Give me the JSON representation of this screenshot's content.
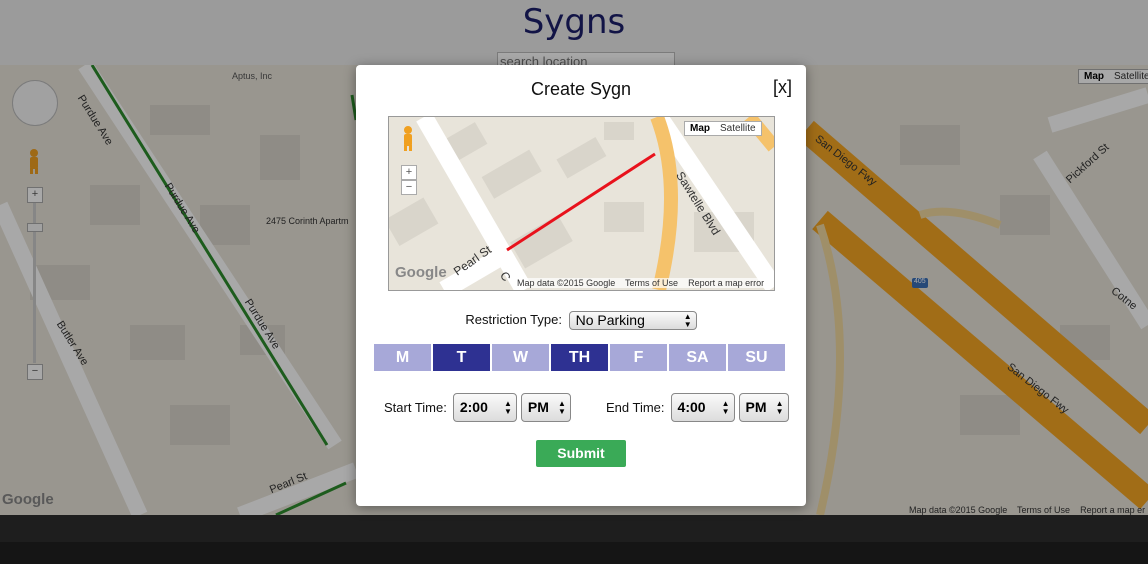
{
  "header": {
    "title": "Sygns",
    "search_placeholder": "search location"
  },
  "background_map": {
    "map_type": {
      "map": "Map",
      "satellite": "Satellite"
    },
    "labels": {
      "aptus": "Aptus, Inc",
      "apartments": "2475 Corinth Apartm",
      "purdue_1": "Purdue Ave",
      "purdue_2": "Purdue Ave",
      "purdue_3": "Purdue Ave",
      "butler": "Butler Ave",
      "pearl": "Pearl St",
      "san_diego_1": "San Diego Fwy",
      "san_diego_2": "San Diego Fwy",
      "pickford": "Pickford St",
      "cotner": "Cotne",
      "shield": "405"
    },
    "footer": {
      "data": "Map data ©2015 Google",
      "terms": "Terms of Use",
      "report": "Report a map er"
    },
    "logo": "Google",
    "zoom_in": "+",
    "zoom_out": "−"
  },
  "modal": {
    "title": "Create Sygn",
    "close_label": "[x]",
    "mini_map": {
      "map_type": {
        "map": "Map",
        "satellite": "Satellite"
      },
      "labels": {
        "sawtelle": "Sawtelle Blvd",
        "pearl": "Pearl St",
        "c": "C"
      },
      "zoom_in": "+",
      "zoom_out": "−",
      "logo": "Google",
      "footer": {
        "data": "Map data ©2015 Google",
        "terms": "Terms of Use",
        "report": "Report a map error"
      },
      "segment_color": "#e8121c"
    },
    "restriction": {
      "label": "Restriction Type:",
      "value": "No Parking"
    },
    "days": [
      {
        "label": "M",
        "selected": false
      },
      {
        "label": "T",
        "selected": true
      },
      {
        "label": "W",
        "selected": false
      },
      {
        "label": "TH",
        "selected": true
      },
      {
        "label": "F",
        "selected": false
      },
      {
        "label": "SA",
        "selected": false
      },
      {
        "label": "SU",
        "selected": false
      }
    ],
    "start_time": {
      "label": "Start Time:",
      "time": "2:00",
      "period": "PM"
    },
    "end_time": {
      "label": "End Time:",
      "time": "4:00",
      "period": "PM"
    },
    "submit_label": "Submit"
  },
  "colors": {
    "title": "#1c1f6b",
    "day_selected": "#2e3192",
    "day_unselected": "#a7a8d8",
    "submit": "#3aaa57",
    "freeway": "#f5a623"
  }
}
